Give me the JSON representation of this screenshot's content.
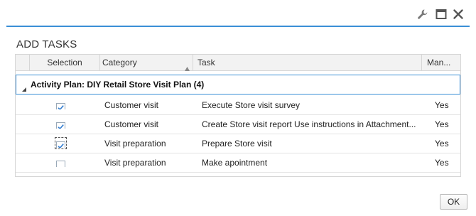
{
  "dialog": {
    "title": "ADD TASKS",
    "accent_color": "#3a8fd6"
  },
  "window_controls": {
    "icons": [
      "wrench-icon",
      "maximize-icon",
      "close-icon"
    ]
  },
  "table": {
    "columns": [
      {
        "key": "selection",
        "label": "Selection"
      },
      {
        "key": "category",
        "label": "Category",
        "sorted": "ascending"
      },
      {
        "key": "task",
        "label": "Task"
      },
      {
        "key": "mandatory",
        "label": "Man..."
      }
    ],
    "group": {
      "label": "Activity Plan:  DIY Retail Store Visit Plan (4)",
      "expanded": true
    },
    "rows": [
      {
        "selected": true,
        "category": "Customer visit",
        "task": "Execute Store visit survey",
        "mandatory": "Yes"
      },
      {
        "selected": true,
        "category": "Customer visit",
        "task": "Create Store visit report Use instructions in Attachment...",
        "mandatory": "Yes"
      },
      {
        "selected": true,
        "category": "Visit preparation",
        "task": "Prepare Store visit",
        "mandatory": "Yes",
        "focused": true
      },
      {
        "selected": false,
        "category": "Visit preparation",
        "task": "Make apointment",
        "mandatory": "Yes"
      }
    ]
  },
  "footer": {
    "ok_label": "OK"
  }
}
